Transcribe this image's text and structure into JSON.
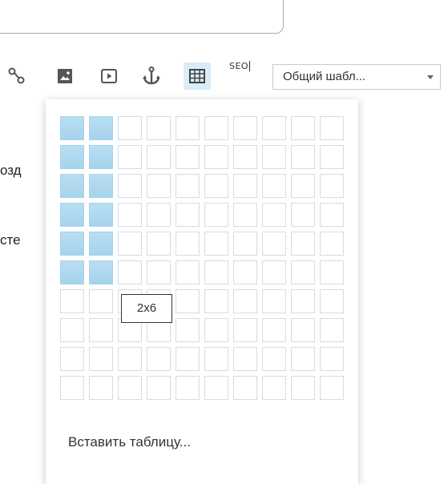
{
  "toolbar": {
    "icons": [
      "link-icon",
      "image-icon",
      "video-icon",
      "anchor-icon",
      "table-icon"
    ],
    "seo_label": "SEO",
    "template_select": {
      "value": "Общий шабл..."
    }
  },
  "background_text": {
    "line1": "озд",
    "line2": "сте"
  },
  "table_picker": {
    "columns": 10,
    "rows": 10,
    "selected_cols": 2,
    "selected_rows": 6,
    "tooltip": "2x6",
    "insert_label": "Вставить таблицу..."
  },
  "colors": {
    "selected_cell": "#a6d3ec",
    "cell_border": "#d2dde4",
    "active_button": "#d9edf8"
  }
}
